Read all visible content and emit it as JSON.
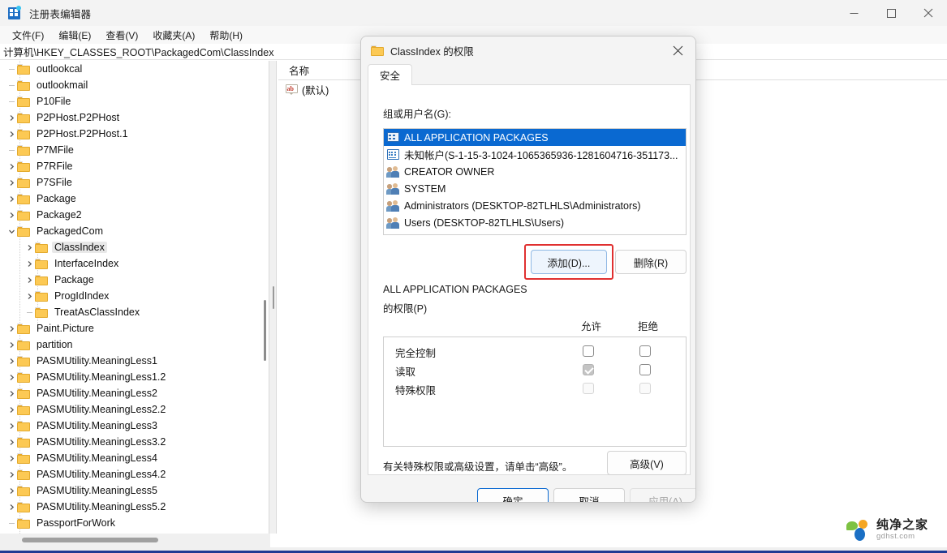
{
  "window": {
    "title": "注册表编辑器",
    "icon": "registry-editor-icon",
    "controls": {
      "minimize": "minimize-icon",
      "maximize": "maximize-icon",
      "close": "close-icon"
    },
    "menus": [
      {
        "label": "文件(F)"
      },
      {
        "label": "编辑(E)"
      },
      {
        "label": "查看(V)"
      },
      {
        "label": "收藏夹(A)"
      },
      {
        "label": "帮助(H)"
      }
    ],
    "address": "计算机\\HKEY_CLASSES_ROOT\\PackagedCom\\ClassIndex"
  },
  "tree": {
    "items": [
      {
        "label": "outlookcal",
        "indent": 1,
        "marker": "stub",
        "selected": false
      },
      {
        "label": "outlookmail",
        "indent": 1,
        "marker": "stub",
        "selected": false
      },
      {
        "label": "P10File",
        "indent": 1,
        "marker": "stub",
        "selected": false
      },
      {
        "label": "P2PHost.P2PHost",
        "indent": 1,
        "marker": "collapsed",
        "selected": false
      },
      {
        "label": "P2PHost.P2PHost.1",
        "indent": 1,
        "marker": "collapsed",
        "selected": false
      },
      {
        "label": "P7MFile",
        "indent": 1,
        "marker": "stub",
        "selected": false
      },
      {
        "label": "P7RFile",
        "indent": 1,
        "marker": "collapsed",
        "selected": false
      },
      {
        "label": "P7SFile",
        "indent": 1,
        "marker": "collapsed",
        "selected": false
      },
      {
        "label": "Package",
        "indent": 1,
        "marker": "collapsed",
        "selected": false
      },
      {
        "label": "Package2",
        "indent": 1,
        "marker": "collapsed",
        "selected": false
      },
      {
        "label": "PackagedCom",
        "indent": 1,
        "marker": "expanded",
        "selected": false
      },
      {
        "label": "ClassIndex",
        "indent": 2,
        "marker": "collapsed",
        "selected": true
      },
      {
        "label": "InterfaceIndex",
        "indent": 2,
        "marker": "collapsed",
        "selected": false
      },
      {
        "label": "Package",
        "indent": 2,
        "marker": "collapsed",
        "selected": false
      },
      {
        "label": "ProgIdIndex",
        "indent": 2,
        "marker": "collapsed",
        "selected": false
      },
      {
        "label": "TreatAsClassIndex",
        "indent": 2,
        "marker": "stub",
        "selected": false
      },
      {
        "label": "Paint.Picture",
        "indent": 1,
        "marker": "collapsed",
        "selected": false
      },
      {
        "label": "partition",
        "indent": 1,
        "marker": "collapsed",
        "selected": false
      },
      {
        "label": "PASMUtility.MeaningLess1",
        "indent": 1,
        "marker": "collapsed",
        "selected": false
      },
      {
        "label": "PASMUtility.MeaningLess1.2",
        "indent": 1,
        "marker": "collapsed",
        "selected": false
      },
      {
        "label": "PASMUtility.MeaningLess2",
        "indent": 1,
        "marker": "collapsed",
        "selected": false
      },
      {
        "label": "PASMUtility.MeaningLess2.2",
        "indent": 1,
        "marker": "collapsed",
        "selected": false
      },
      {
        "label": "PASMUtility.MeaningLess3",
        "indent": 1,
        "marker": "collapsed",
        "selected": false
      },
      {
        "label": "PASMUtility.MeaningLess3.2",
        "indent": 1,
        "marker": "collapsed",
        "selected": false
      },
      {
        "label": "PASMUtility.MeaningLess4",
        "indent": 1,
        "marker": "collapsed",
        "selected": false
      },
      {
        "label": "PASMUtility.MeaningLess4.2",
        "indent": 1,
        "marker": "collapsed",
        "selected": false
      },
      {
        "label": "PASMUtility.MeaningLess5",
        "indent": 1,
        "marker": "collapsed",
        "selected": false
      },
      {
        "label": "PASMUtility.MeaningLess5.2",
        "indent": 1,
        "marker": "collapsed",
        "selected": false
      },
      {
        "label": "PassportForWork",
        "indent": 1,
        "marker": "stub",
        "selected": false
      }
    ]
  },
  "list": {
    "column_header": "名称",
    "rows": [
      {
        "name": "(默认)",
        "icon": "ab-string-icon"
      }
    ]
  },
  "dialog": {
    "title": "ClassIndex 的权限",
    "close_icon": "close-icon",
    "tabs": [
      {
        "label": "安全",
        "selected": true
      }
    ],
    "group_label": "组或用户名(G):",
    "users": [
      {
        "name": "ALL APPLICATION PACKAGES",
        "icon": "package-icon",
        "selected": true
      },
      {
        "name": "未知帐户(S-1-15-3-1024-1065365936-1281604716-351173...",
        "icon": "unknown-account-icon",
        "selected": false
      },
      {
        "name": "CREATOR OWNER",
        "icon": "users-icon",
        "selected": false
      },
      {
        "name": "SYSTEM",
        "icon": "users-icon",
        "selected": false
      },
      {
        "name": "Administrators (DESKTOP-82TLHLS\\Administrators)",
        "icon": "users-icon",
        "selected": false
      },
      {
        "name": "Users (DESKTOP-82TLHLS\\Users)",
        "icon": "users-icon",
        "selected": false
      }
    ],
    "add_button": "添加(D)...",
    "remove_button": "删除(R)",
    "perm_label_line1": "ALL APPLICATION PACKAGES",
    "perm_label_line2": "的权限(P)",
    "col_allow": "允许",
    "col_deny": "拒绝",
    "permissions": [
      {
        "name": "完全控制",
        "allow": "unchecked",
        "deny": "unchecked"
      },
      {
        "name": "读取",
        "allow": "checked-disabled",
        "deny": "unchecked"
      },
      {
        "name": "特殊权限",
        "allow": "dim",
        "deny": "dim"
      }
    ],
    "hint": "有关特殊权限或高级设置，请单击“高级”。",
    "advanced_button": "高级(V)",
    "ok_button": "确定",
    "cancel_button": "取消",
    "apply_button": "应用(A)",
    "highlight_color": "#e03030",
    "accent_color": "#0a69d1"
  },
  "watermark": {
    "cn": "纯净之家",
    "en": "gdhst.com"
  }
}
